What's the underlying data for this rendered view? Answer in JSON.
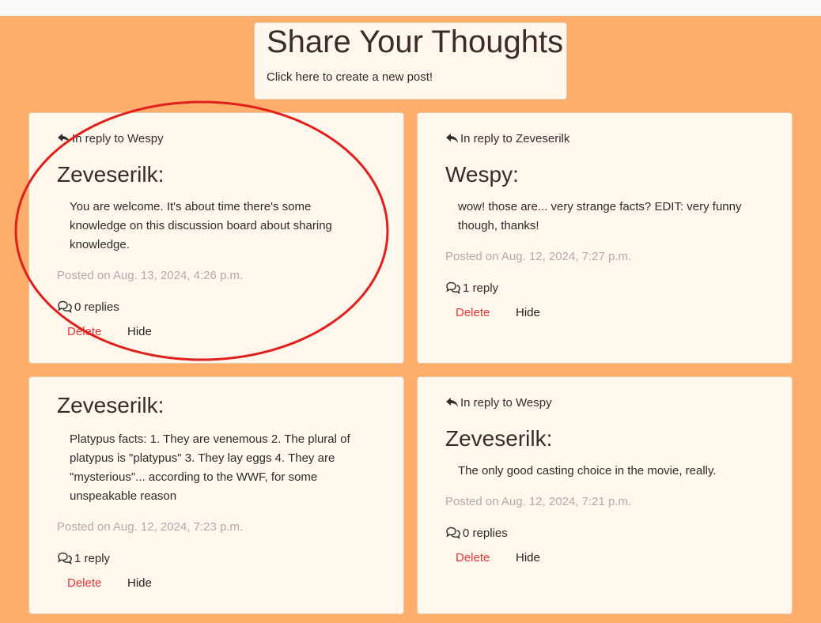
{
  "header": {
    "title": "Share Your Thoughts",
    "create_link": "Click here to create a new post!"
  },
  "posts": [
    {
      "reply_to": "In reply to Wespy",
      "author": "Zeveserilk:",
      "content": "You are welcome. It's about time there's some knowledge on this discussion board about sharing knowledge.",
      "posted": "Posted on Aug. 13, 2024, 4:26 p.m.",
      "replies": "0 replies",
      "delete_label": "Delete",
      "hide_label": "Hide"
    },
    {
      "reply_to": "In reply to Zeveserilk",
      "author": "Wespy:",
      "content": "wow! those are... very strange facts? EDIT: very funny though, thanks!",
      "posted": "Posted on Aug. 12, 2024, 7:27 p.m.",
      "replies": "1 reply",
      "delete_label": "Delete",
      "hide_label": "Hide"
    },
    {
      "reply_to": "",
      "author": "Zeveserilk:",
      "content": "Platypus facts: 1. They are venemous 2. The plural of platypus is \"platypus\" 3. They lay eggs 4. They are \"mysterious\"... according to the WWF, for some unspeakable reason",
      "posted": "Posted on Aug. 12, 2024, 7:23 p.m.",
      "replies": "1 reply",
      "delete_label": "Delete",
      "hide_label": "Hide"
    },
    {
      "reply_to": "In reply to Wespy",
      "author": "Zeveserilk:",
      "content": "The only good casting choice in the movie, really.",
      "posted": "Posted on Aug. 12, 2024, 7:21 p.m.",
      "replies": "0 replies",
      "delete_label": "Delete",
      "hide_label": "Hide"
    }
  ],
  "colors": {
    "background": "#ffad6b",
    "card": "#fff6ec",
    "delete": "#e4363a",
    "posted": "#b1aab0",
    "annotation": "#e0201c"
  }
}
